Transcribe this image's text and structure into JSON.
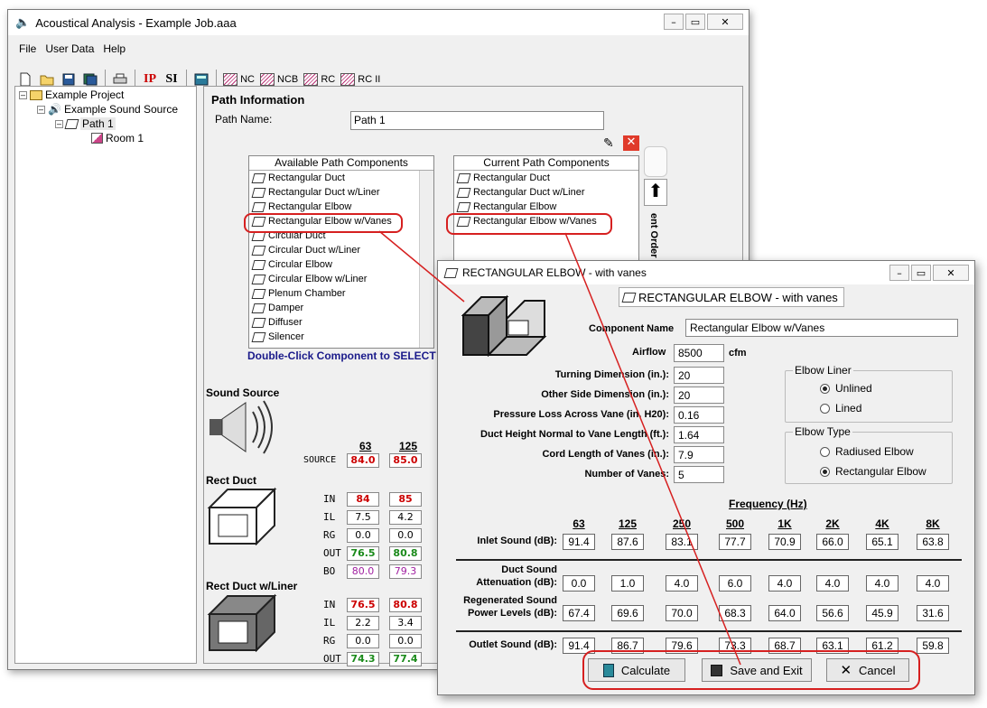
{
  "main_window": {
    "title": "Acoustical Analysis - Example Job.aaa",
    "menu": [
      "File",
      "User Data",
      "Help"
    ],
    "toolbar": {
      "ip": "IP",
      "si": "SI",
      "nc": "NC",
      "ncb": "NCB",
      "rc": "RC",
      "rc2": "RC II"
    }
  },
  "tree": {
    "project": "Example Project",
    "source": "Example Sound Source",
    "path": "Path 1",
    "room": "Room 1"
  },
  "path_info": {
    "heading": "Path Information",
    "name_label": "Path Name:",
    "name_value": "Path 1",
    "available_header": "Available Path Components",
    "current_header": "Current Path Components",
    "available": [
      "Rectangular Duct",
      "Rectangular Duct w/Liner",
      "Rectangular Elbow",
      "Rectangular Elbow w/Vanes",
      "Circular Duct",
      "Circular Duct w/Liner",
      "Circular Elbow",
      "Circular Elbow w/Liner",
      "Plenum Chamber",
      "Damper",
      "Diffuser",
      "Silencer"
    ],
    "current": [
      "Rectangular Duct",
      "Rectangular Duct w/Liner",
      "Rectangular Elbow",
      "Rectangular Elbow w/Vanes"
    ],
    "hint": "Double-Click Component to SELECT",
    "order_label": "ent Order"
  },
  "left_rows": {
    "sound_source": "Sound Source",
    "freq_63": "63",
    "freq_125": "125",
    "source_label": "SOURCE",
    "source_vals": [
      "84.0",
      "85.0"
    ],
    "rect_duct": "Rect Duct",
    "rd_labels": [
      "IN",
      "IL",
      "RG",
      "OUT",
      "BO"
    ],
    "rd_63": [
      "84",
      "7.5",
      "0.0",
      "76.5",
      "80.0"
    ],
    "rd_125": [
      "85",
      "4.2",
      "0.0",
      "80.8",
      "79.3"
    ],
    "rect_duct_liner": "Rect Duct w/Liner",
    "rdl_labels": [
      "IN",
      "IL",
      "RG",
      "OUT"
    ],
    "rdl_63": [
      "76.5",
      "2.2",
      "0.0",
      "74.3"
    ],
    "rdl_125": [
      "80.8",
      "3.4",
      "0.0",
      "77.4"
    ]
  },
  "dialog": {
    "title": "RECTANGULAR ELBOW - with vanes",
    "header_label": "RECTANGULAR ELBOW - with vanes",
    "component_name_label": "Component Name",
    "component_name": "Rectangular Elbow w/Vanes",
    "airflow_label": "Airflow",
    "airflow": "8500",
    "airflow_unit": "cfm",
    "params": [
      {
        "label": "Turning Dimension (in.):",
        "value": "20"
      },
      {
        "label": "Other Side Dimension (in.):",
        "value": "20"
      },
      {
        "label": "Pressure Loss Across Vane (in. H20):",
        "value": "0.16"
      },
      {
        "label": "Duct Height Normal to Vane Length (ft.):",
        "value": "1.64"
      },
      {
        "label": "Cord Length of Vanes (in.):",
        "value": "7.9"
      },
      {
        "label": "Number of Vanes:",
        "value": "5"
      }
    ],
    "liner_title": "Elbow Liner",
    "liner_opts": [
      "Unlined",
      "Lined"
    ],
    "type_title": "Elbow Type",
    "type_opts": [
      "Radiused Elbow",
      "Rectangular Elbow"
    ],
    "freq_title": "Frequency (Hz)",
    "freqs": [
      "63",
      "125",
      "250",
      "500",
      "1K",
      "2K",
      "4K",
      "8K"
    ],
    "inlet_label": "Inlet Sound (dB):",
    "inlet": [
      "91.4",
      "87.6",
      "83.1",
      "77.7",
      "70.9",
      "66.0",
      "65.1",
      "63.8"
    ],
    "atten_label1": "Duct Sound",
    "atten_label2": "Attenuation (dB):",
    "atten": [
      "0.0",
      "1.0",
      "4.0",
      "6.0",
      "4.0",
      "4.0",
      "4.0",
      "4.0"
    ],
    "regen_label1": "Regenerated Sound",
    "regen_label2": "Power Levels (dB):",
    "regen": [
      "67.4",
      "69.6",
      "70.0",
      "68.3",
      "64.0",
      "56.6",
      "45.9",
      "31.6"
    ],
    "outlet_label": "Outlet Sound (dB):",
    "outlet": [
      "91.4",
      "86.7",
      "79.6",
      "73.3",
      "68.7",
      "63.1",
      "61.2",
      "59.8"
    ],
    "btn_calculate": "Calculate",
    "btn_save": "Save and Exit",
    "btn_cancel": "Cancel"
  },
  "colors": {
    "highlight": "#d62020",
    "in_red": "#cc0000",
    "out_green": "#1a8a1a",
    "bo_purple": "#a020a0",
    "hint_blue": "#1a1a8a"
  }
}
